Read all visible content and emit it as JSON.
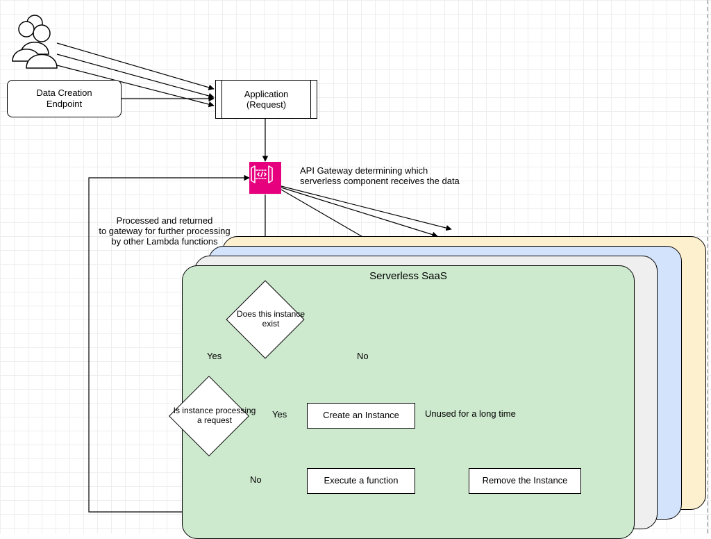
{
  "nodes": {
    "data_creation": "Data Creation\nEndpoint",
    "application": "Application\n(Request)",
    "api_gateway_note": "API Gateway determining which\nserverless component receives the data",
    "return_note": "Processed and returned\nto gateway for further processing\nby other Lambda functions",
    "decision_exist": "Does this\ninstance exist",
    "decision_processing": "Is instance\nprocessing a\nrequest",
    "create_instance": "Create an Instance",
    "execute_function": "Execute a function",
    "remove_instance": "Remove the Instance",
    "saas_title": "Serverless SaaS"
  },
  "edges": {
    "yes1": "Yes",
    "no1": "No",
    "yes2": "Yes",
    "no2": "No",
    "unused": "Unused for a long time"
  },
  "icons": {
    "api_gateway": "api-gateway-icon"
  },
  "colors": {
    "saas_green": "#cde9ce",
    "saas_grey": "#efefef",
    "saas_blue": "#d3e3fb",
    "saas_yellow": "#fdf0cf",
    "api_pink": "#e6007e"
  }
}
